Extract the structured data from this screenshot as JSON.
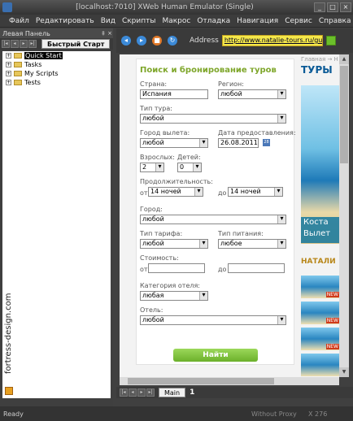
{
  "window": {
    "title": "[localhost:7010] XWeb Human Emulator (Single)"
  },
  "menu": [
    "Файл",
    "Редактировать",
    "Вид",
    "Скрипты",
    "Макрос",
    "Отладка",
    "Навигация",
    "Сервис",
    "Справка"
  ],
  "left_panel": {
    "header": "Левая Панель",
    "tab": "Быстрый Старт",
    "tree": [
      "Quick Start",
      "Tasks",
      "My Scripts",
      "Tests"
    ],
    "selected": "Quick Start",
    "vertical_label": "fortress-design.com"
  },
  "nav": {
    "address_label": "Address",
    "url": "http://www.natalie-tours.ru/guide/..."
  },
  "form": {
    "title": "Поиск и бронирование туров",
    "country_label": "Страна:",
    "country_value": "Испания",
    "region_label": "Регион:",
    "region_value": "любой",
    "tour_type_label": "Тип тура:",
    "tour_type_value": "любой",
    "departure_city_label": "Город вылета:",
    "departure_city_value": "любой",
    "date_label": "Дата предоставления:",
    "date_value": "26.08.2011",
    "calendar_day": "28",
    "adults_label": "Взрослых:",
    "adults_value": "2",
    "children_label": "Детей:",
    "children_value": "0",
    "duration_label": "Продолжительность:",
    "from_label": "от",
    "from_value": "14 ночей",
    "to_label": "до",
    "to_value": "14 ночей",
    "city_label": "Город:",
    "city_value": "любой",
    "tariff_label": "Тип тарифа:",
    "tariff_value": "любой",
    "meal_label": "Тип питания:",
    "meal_value": "любое",
    "cost_label": "Стоимость:",
    "cost_from_label": "от",
    "cost_to_label": "до",
    "hotel_category_label": "Категория отеля:",
    "hotel_category_value": "любая",
    "hotel_label": "Отель:",
    "hotel_value": "любой",
    "find_button": "Найти"
  },
  "ads": {
    "breadcrumb": "Главная → Н",
    "heading": "ТУРЫ",
    "promo_line1": "Коста",
    "promo_line2": "Вылет",
    "natali": "НАТАЛИ",
    "new_badge": "NEW"
  },
  "bottom_tabs": {
    "tab": "Main",
    "count": "1"
  },
  "status": {
    "ready": "Ready",
    "proxy": "Without Proxy",
    "coords": "X 276"
  }
}
